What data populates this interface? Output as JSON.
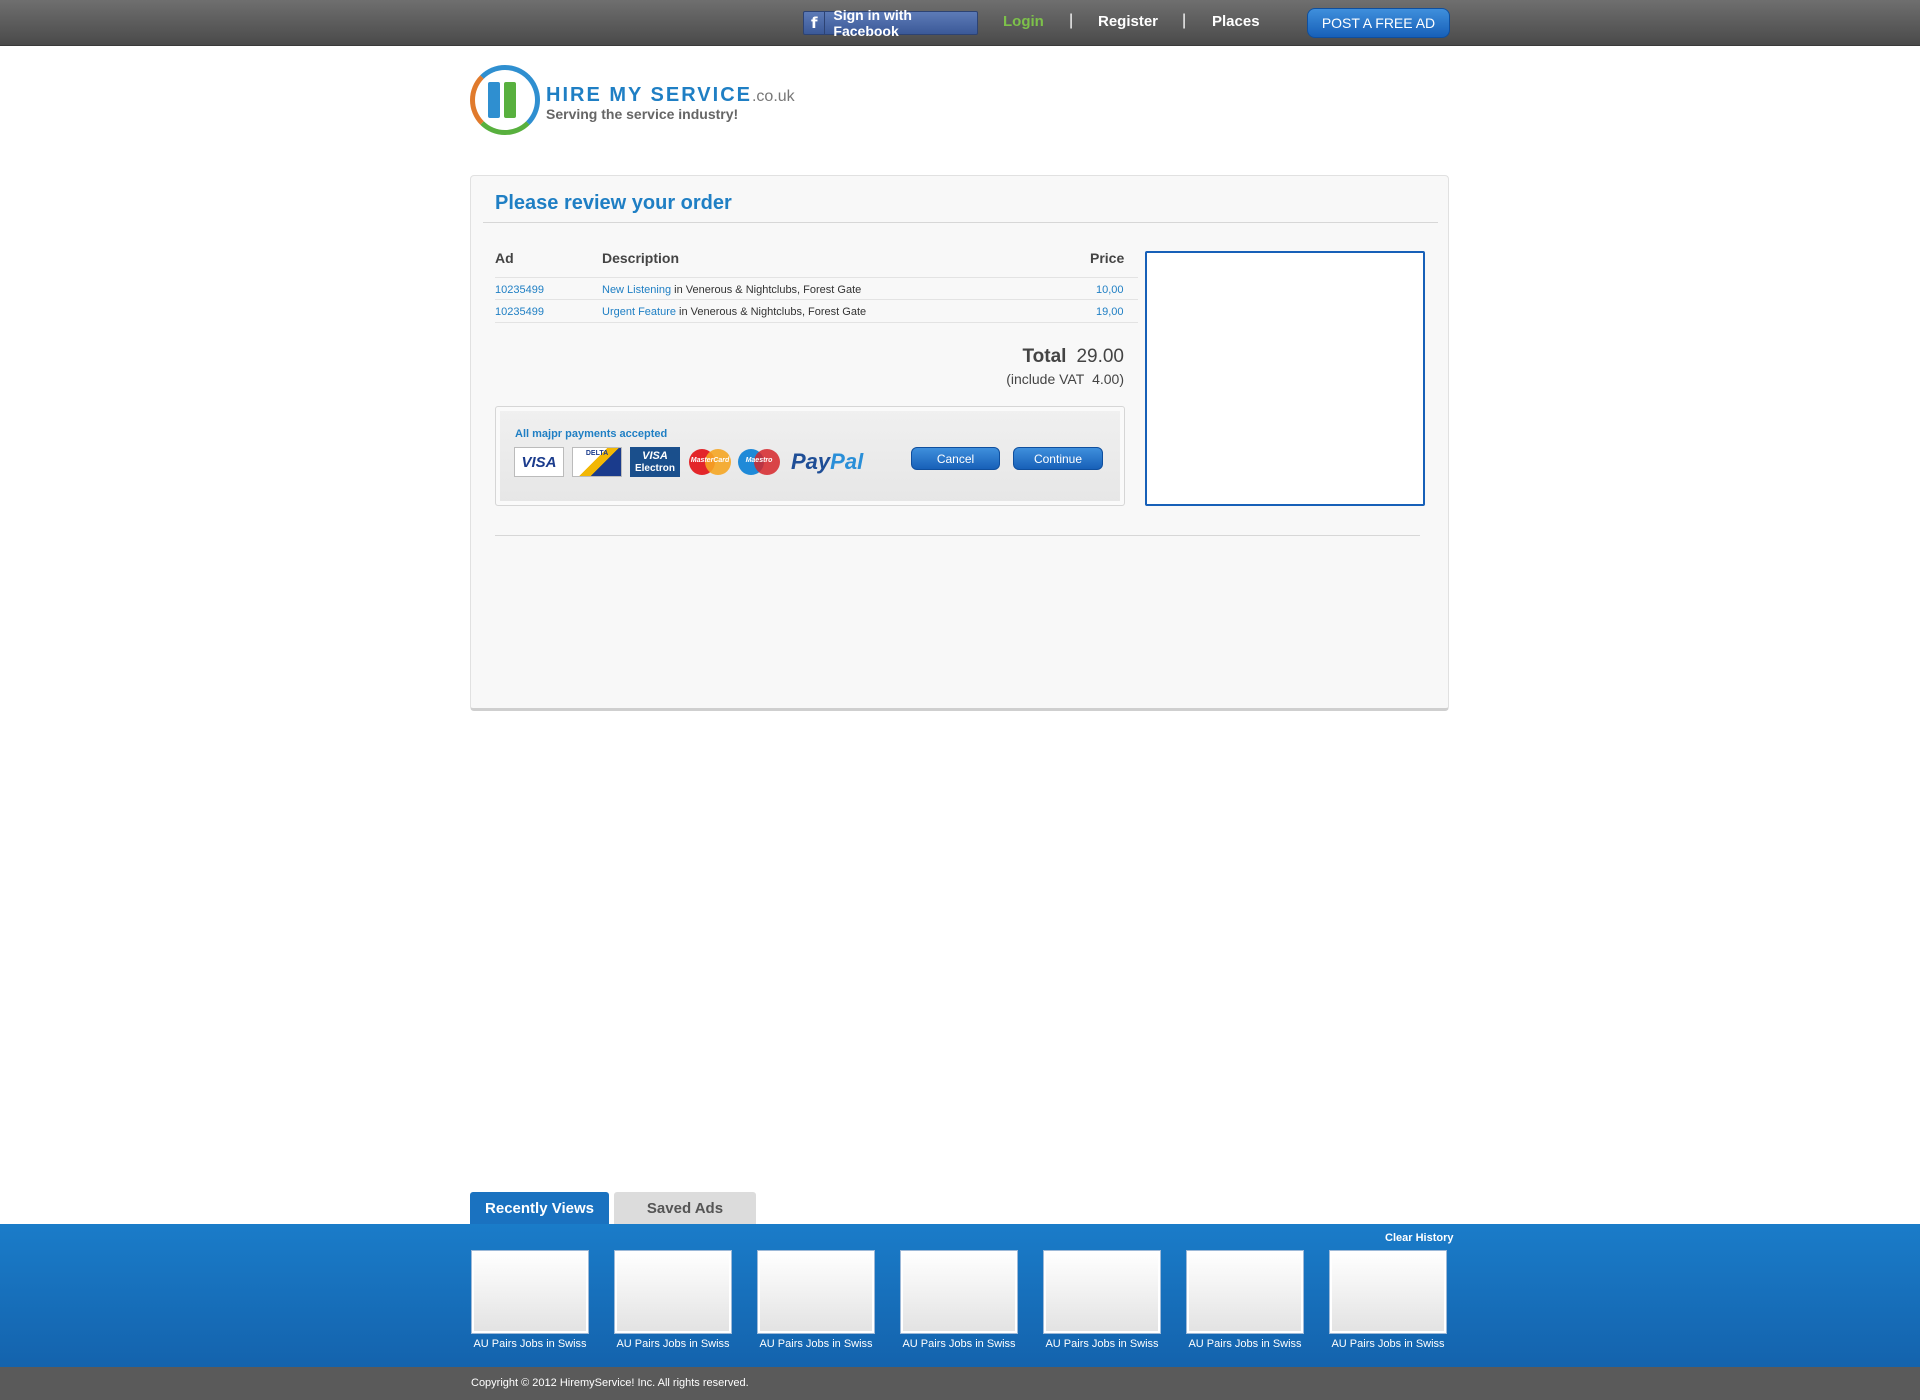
{
  "topbar": {
    "facebook_icon": "facebook-icon",
    "facebook_label": "Sign in with Facebook",
    "login": "Login",
    "register": "Register",
    "places": "Places",
    "separator": "|",
    "post_ad": "POST A FREE AD",
    "login_color": "#7dc14a"
  },
  "logo": {
    "title": "HIRE MY SERVICE",
    "domain": ".co.uk",
    "tagline": "Serving the service industry!"
  },
  "order": {
    "heading": "Please review your order",
    "columns": {
      "ad": "Ad",
      "description": "Description",
      "price": "Price"
    },
    "rows": [
      {
        "ad": "10235499",
        "item": "New Listening",
        "detail": " in Venerous & Nightclubs, Forest Gate",
        "price": "10,00"
      },
      {
        "ad": "10235499",
        "item": "Urgent Feature",
        "detail": " in Venerous & Nightclubs, Forest Gate",
        "price": "19,00"
      }
    ],
    "total_label": "Total",
    "total_value": "29.00",
    "vat_label": "(include VAT",
    "vat_value": "4.00)"
  },
  "payments": {
    "label": "All majpr payments accepted",
    "cards": [
      "VISA",
      "DELTA",
      "VISA",
      "Electron",
      "MasterCard",
      "Maestro"
    ],
    "paypal_1": "Pay",
    "paypal_2": "Pal",
    "cancel": "Cancel",
    "continue": "Continue"
  },
  "recent": {
    "tab_recent": "Recently Views",
    "tab_saved": "Saved Ads",
    "clear": "Clear History",
    "items": [
      "AU Pairs Jobs in Swiss",
      "AU Pairs Jobs in Swiss",
      "AU Pairs Jobs in Swiss",
      "AU Pairs Jobs in Swiss",
      "AU Pairs Jobs in Swiss",
      "AU Pairs Jobs in Swiss",
      "AU Pairs Jobs in Swiss"
    ]
  },
  "footer": {
    "copyright": "Copyright © 2012 HiremyService! Inc. All rights reserved."
  },
  "colors": {
    "brand_blue": "#1f7fc4",
    "footer_blue": "#1a7cc9",
    "button_blue": "#1760b8"
  }
}
